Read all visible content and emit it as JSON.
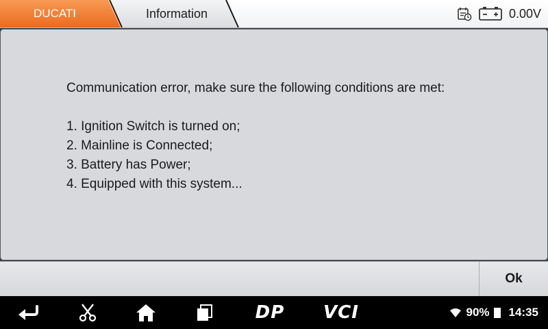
{
  "header": {
    "brand_tab": "DUCATI",
    "page_tab": "Information",
    "voltage": "0.00V",
    "icons": [
      "calendar-clock-icon",
      "battery-icon"
    ],
    "colors": {
      "brand_tab": "#f0792e",
      "info_tab": "#e4e5e7"
    }
  },
  "dialog": {
    "heading": "Communication error,  make sure the following conditions are met:",
    "conditions": [
      "1. Ignition Switch is turned on;",
      "2. Mainline is Connected;",
      "3. Battery has Power;",
      "4. Equipped with this system..."
    ]
  },
  "buttons": {
    "ok_label": "Ok"
  },
  "navbar": {
    "icons": [
      "back-icon",
      "scissors-icon",
      "home-icon",
      "recent-apps-icon"
    ],
    "dp_label": "DP",
    "vci_label": "VCI",
    "battery_percent": "90%",
    "time": "14:35"
  }
}
